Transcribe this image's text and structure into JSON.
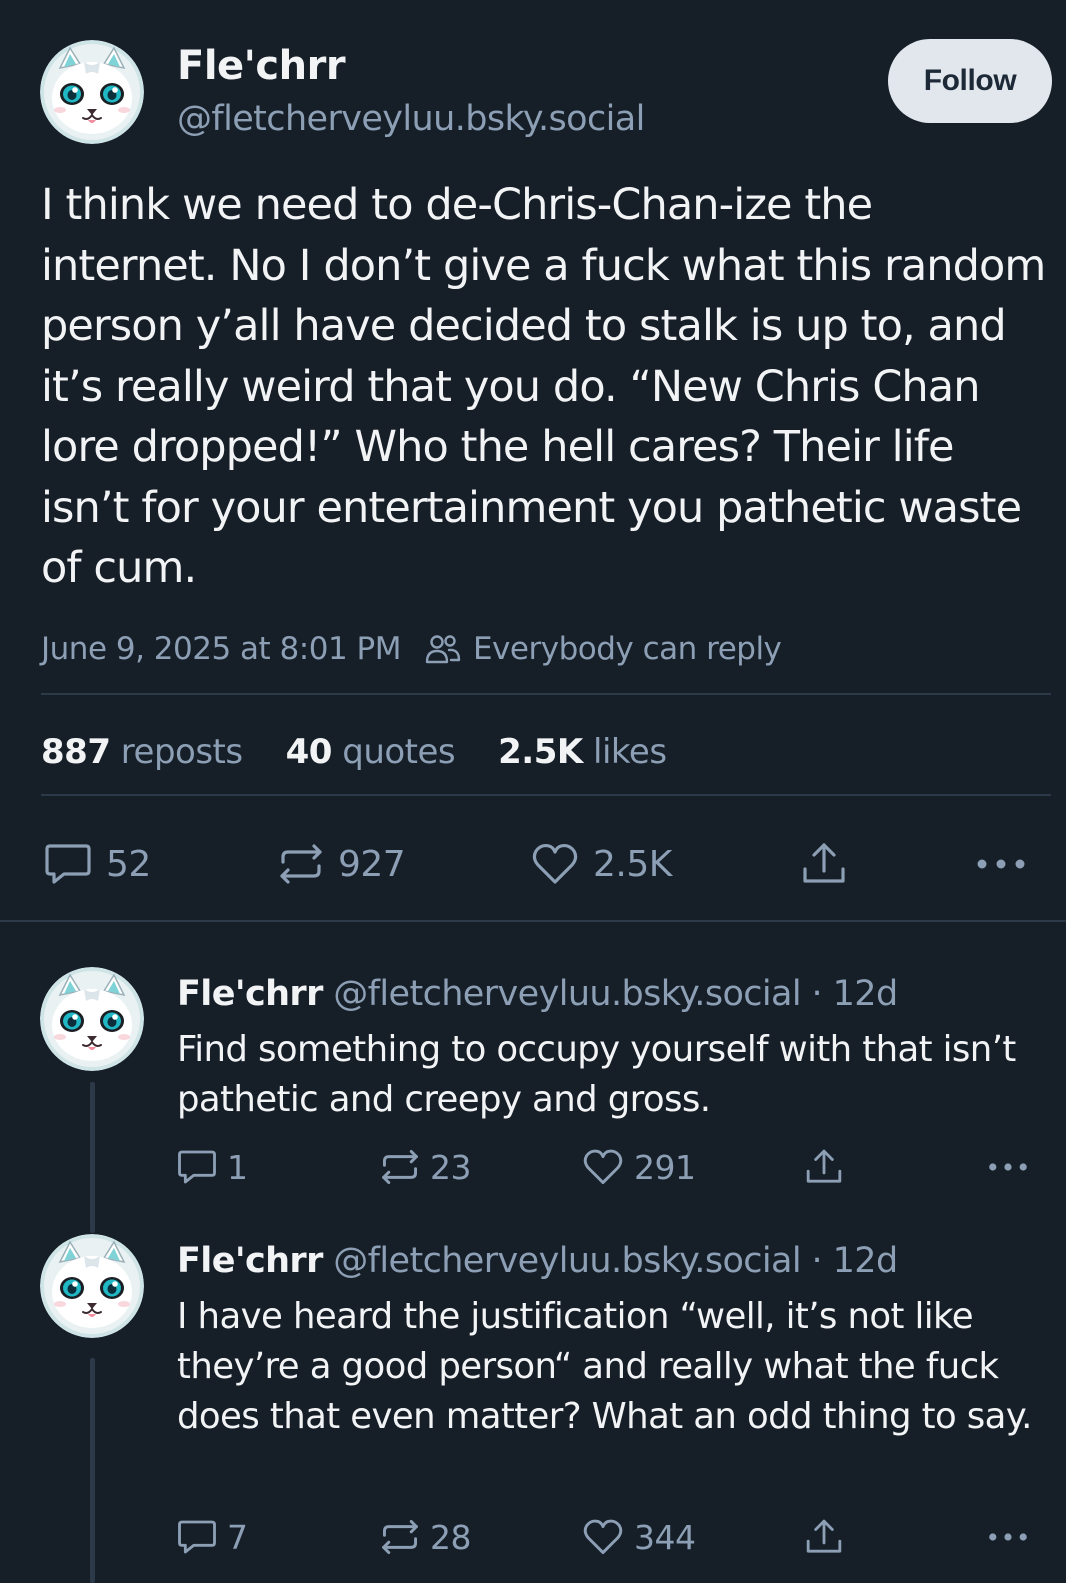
{
  "post": {
    "author_name": "Fle'chrr",
    "author_handle": "@fletcherveyluu.bsky.social",
    "follow_label": "Follow",
    "text": "I think we need to de-Chris-Chan-ize the internet. No I don’t give a fuck what this random person y’all have decided to stalk is up to, and it’s really weird that you do. “New Chris Chan lore dropped!” Who the hell cares? Their life isn’t for your entertainment you pathetic waste of cum.",
    "timestamp": "June 9, 2025 at 8:01 PM",
    "reply_setting": "Everybody can reply",
    "stats": {
      "reposts_count": "887",
      "reposts_label": "reposts",
      "quotes_count": "40",
      "quotes_label": "quotes",
      "likes_count": "2.5K",
      "likes_label": "likes"
    },
    "actions": {
      "reply_count": "52",
      "repost_count": "927",
      "like_count": "2.5K"
    }
  },
  "replies": [
    {
      "author_name": "Fle'chrr",
      "author_handle": "@fletcherveyluu.bsky.social",
      "separator": "·",
      "time": "12d",
      "text": "Find something to occupy yourself with that isn’t pathetic and creepy and gross.",
      "reply_count": "1",
      "repost_count": "23",
      "like_count": "291"
    },
    {
      "author_name": "Fle'chrr",
      "author_handle": "@fletcherveyluu.bsky.social",
      "separator": "·",
      "time": "12d",
      "text": "I have heard the justification “well, it’s not like they’re a good person“ and really what the fuck does that even matter? What an odd thing to say.",
      "reply_count": "7",
      "repost_count": "28",
      "like_count": "344"
    }
  ],
  "icons": {
    "reply": "speech-bubble-icon",
    "repost": "repost-arrows-icon",
    "like": "heart-icon",
    "share": "share-upload-icon",
    "more": "more-dots-icon",
    "people": "people-icon"
  },
  "colors": {
    "background": "#161e27",
    "text": "#f1f3f5",
    "muted": "#8c9fb5",
    "divider": "#2b3948",
    "follow_button_bg": "#e2e7ee",
    "follow_button_text": "#1d2936"
  }
}
